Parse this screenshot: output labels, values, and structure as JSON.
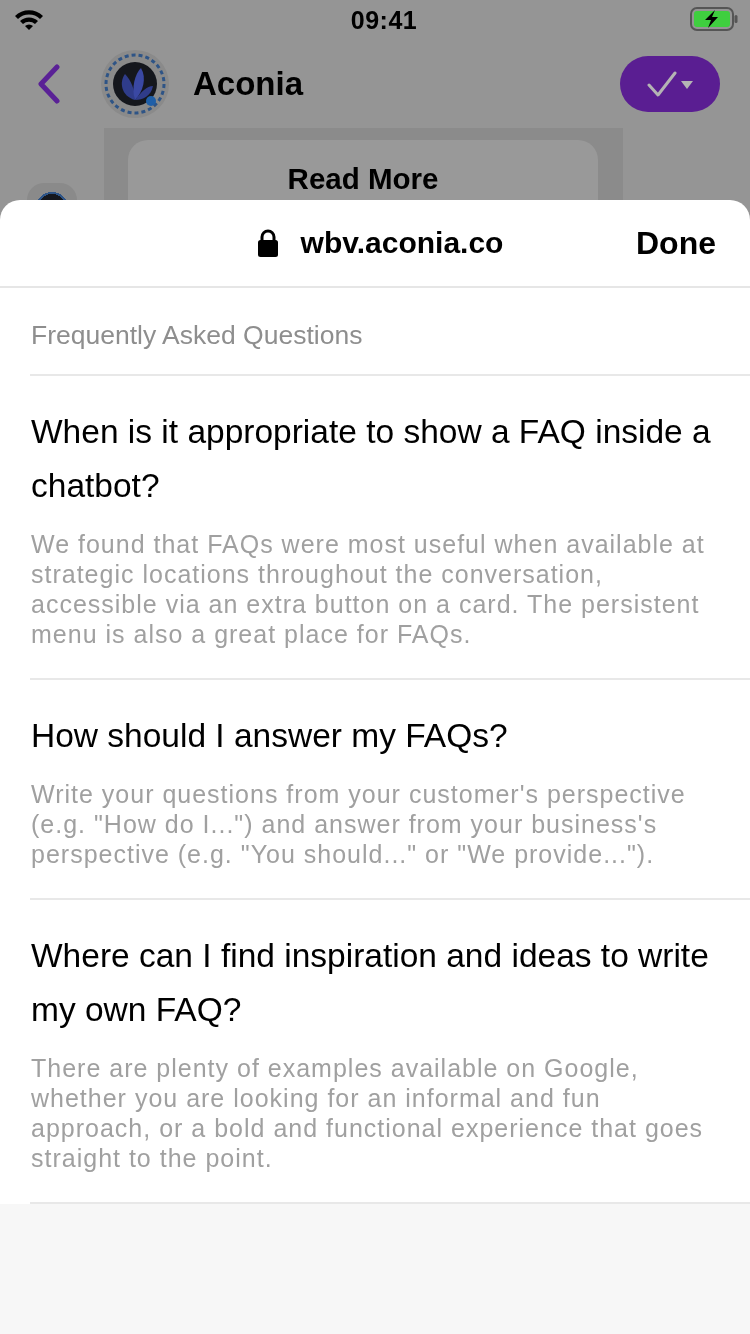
{
  "status_bar": {
    "time": "09:41"
  },
  "chat_header": {
    "title": "Aconia"
  },
  "chat_card": {
    "button_label": "Read More"
  },
  "browser_sheet": {
    "url": "wbv.aconia.co",
    "done_label": "Done"
  },
  "faq": {
    "heading": "Frequently Asked Questions",
    "items": [
      {
        "question": "When is it appropriate to show a FAQ inside a chatbot?",
        "answer": "We found that FAQs were most useful when available at strategic locations throughout the conversation, accessible via an extra button on a card. The persistent menu is also a great place for FAQs."
      },
      {
        "question": "How should I answer my FAQs?",
        "answer": "Write your questions from your customer's perspective (e.g. \"How do I...\") and answer from your business's perspective (e.g. \"You should...\" or \"We provide...\")."
      },
      {
        "question": "Where can I find inspiration and ideas to write my own FAQ?",
        "answer": "There are plenty of examples available on Google, whether you are looking for an informal and fun approach, or a bold and functional experience that goes straight to the point."
      }
    ]
  }
}
